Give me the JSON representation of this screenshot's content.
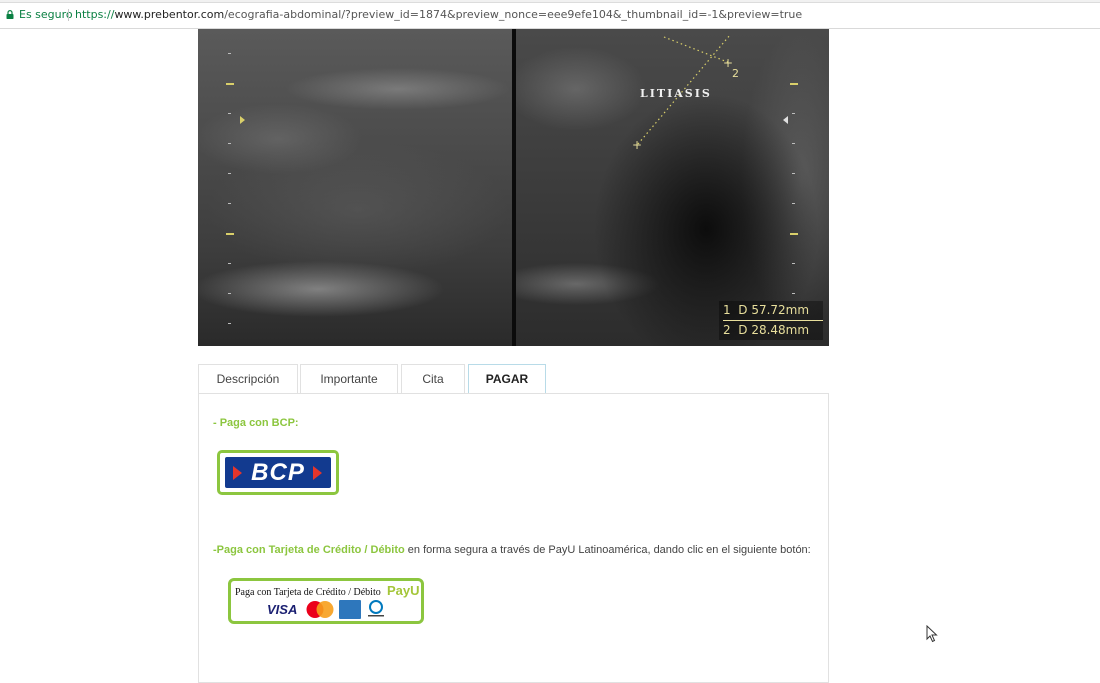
{
  "browser": {
    "secure_label": "Es seguro",
    "url_scheme": "https://",
    "url_host": "www.prebentor.com",
    "url_path": "/ecografia-abdominal/?preview_id=1874&preview_nonce=eee9efe104&_thumbnail_id=-1&preview=true"
  },
  "ultrasound": {
    "label": "LITIASIS",
    "measurement_1": "1  D 57.72mm",
    "measurement_2": "2  D 28.48mm",
    "caliper_2": "2"
  },
  "tabs": [
    {
      "label": "Descripción",
      "active": false
    },
    {
      "label": "Importante",
      "active": false
    },
    {
      "label": "Cita",
      "active": false
    },
    {
      "label": "PAGAR",
      "active": true
    }
  ],
  "payment": {
    "bcp_title": "- Paga con BCP:",
    "bcp_logo_text": "BCP",
    "card_title": "-Paga con Tarjeta de Crédito / Débito",
    "card_text": " en forma segura a través de PayU Latinoamérica, dando clic en el siguiente botón:",
    "payu_button_text": "Paga con Tarjeta de Crédito / Débito",
    "payu_logo": "PayU",
    "visa_text": "VISA"
  },
  "colors": {
    "accent_green": "#8cc63f",
    "bcp_blue": "#123a8f",
    "secure_green": "#0b8043",
    "active_tab_border": "#b8dbe8"
  },
  "icons": {
    "lock": "lock-icon",
    "cursor": "cursor-icon"
  }
}
